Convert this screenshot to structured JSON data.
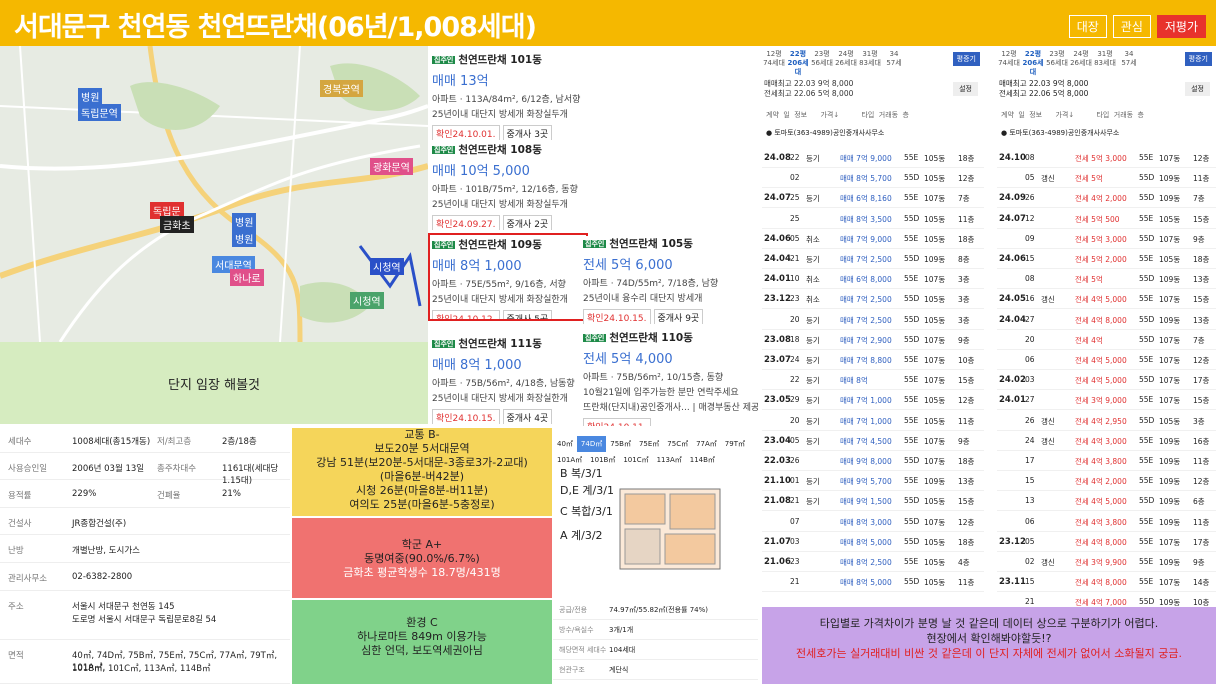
{
  "header": {
    "title": "서대문구 천연동 천연뜨란채(06년/1,008세대)",
    "buttons": [
      "대장",
      "관심",
      "저평가"
    ]
  },
  "map": {
    "labels": [
      "병원",
      "독립문역",
      "경복궁역",
      "광화문역",
      "독립문",
      "금화초",
      "병원",
      "병원",
      "서대문역",
      "하나로",
      "시청역",
      "시청역"
    ]
  },
  "impression": "단지 임장 해볼것",
  "listings": [
    {
      "tag": "집주인",
      "name": "천연뜨란채 101동",
      "price": "매매 13억",
      "line1": "아파트 · 113A/84m², 6/12층, 남서향",
      "line2": "25년이내  대단지  방세개  화장실두개",
      "date": "확인24.10.01.",
      "agents": "중개사 3곳"
    },
    {
      "tag": "집주인",
      "name": "천연뜨란채 108동",
      "price": "매매 10억 5,000",
      "line1": "아파트 · 101B/75m², 12/16층, 동향",
      "line2": "25년이내  대단지  방세개  화장실두개",
      "date": "확인24.09.27.",
      "agents": "중개사 2곳"
    },
    {
      "tag": "집주인",
      "name": "천연뜨란채 109동",
      "price": "매매 8억 1,000",
      "line1": "아파트 · 75E/55m², 9/16층, 서향",
      "line2": "25년이내  대단지  방세개  화장실한개",
      "date": "확인24.10.12.",
      "agents": "중개사 5곳"
    },
    {
      "tag": "집주인",
      "name": "천연뜨란채 105동",
      "price": "전세 5억 6,000",
      "line1": "아파트 · 74D/55m², 7/18층, 남향",
      "line2": "25년이내  융수리  대단지  방세개",
      "date": "확인24.10.15.",
      "agents": "중개사 9곳"
    },
    {
      "tag": "집주인",
      "name": "천연뜨란채 111동",
      "price": "매매 8억 1,000",
      "line1": "아파트 · 75B/56m², 4/18층, 남동향",
      "line2": "25년이내  대단지  방세개  화장실한개",
      "date": "확인24.10.15.",
      "agents": "중개사 4곳"
    },
    {
      "tag": "집주인",
      "name": "천연뜨란채 110동",
      "price": "전세 5억 4,000",
      "line1": "아파트 · 75B/56m², 10/15층, 동향",
      "line2": "10월21일에 입주가능한 분만 연락주세요",
      "line3": "뜨란채(단지내)공인중개사...  | 매경부동산 제공",
      "date": "확인24.10.11.",
      "agents": ""
    }
  ],
  "info": [
    {
      "k": "세대수",
      "v": "1008세대(총15개동)",
      "k2": "저/최고층",
      "v2": "2층/18층"
    },
    {
      "k": "사용승인일",
      "v": "2006년 03월 13일",
      "k2": "총주차대수",
      "v2": "1161대(세대당 1.15대)"
    },
    {
      "k": "용적률",
      "v": "229%",
      "k2": "건폐율",
      "v2": "21%"
    },
    {
      "k": "건설사",
      "v": "JR종합건설(주)",
      "k2": "",
      "v2": ""
    },
    {
      "k": "난방",
      "v": "개별난방, 도시가스",
      "k2": "",
      "v2": ""
    },
    {
      "k": "관리사무소",
      "v": "02-6382-2800",
      "k2": "",
      "v2": ""
    },
    {
      "k": "주소",
      "v": "서울시 서대문구 천연동 145",
      "v3": "도로명  서울시 서대문구 독립문로8길 54",
      "k2": "",
      "v2": ""
    },
    {
      "k": "면적",
      "v": "40㎡, 74D㎡, 75B㎡, 75E㎡, 75C㎡, 77A㎡, 79T㎡, 101A㎡,",
      "v3": "101B㎡, 101C㎡, 113A㎡, 114B㎡",
      "k2": "",
      "v2": ""
    }
  ],
  "commute": {
    "lines": [
      "교통 B-",
      "보도20분 5서대문역",
      "강남 51분(보20분-5서대문-3종로3가-2교대)",
      "(마을6분-버42분)",
      "시청 26분(마을8분-버11분)",
      "여의도 25분(마을6분-5충정로)"
    ],
    "color": "#f5d55a"
  },
  "school": {
    "lines": [
      "학군 A+",
      "동명여중(90.0%/6.7%)"
    ],
    "sub": "금화초 평균학생수 18.7명/431명",
    "color": "#f07270"
  },
  "env": {
    "lines": [
      "환경 C",
      "하나로마트 849m 이용가능",
      "심한 언덕, 보도역세권아님"
    ],
    "color": "#80d28a"
  },
  "floorplan": {
    "tabs": [
      "40㎡",
      "74D㎡",
      "75B㎡",
      "75E㎡",
      "75C㎡",
      "77A㎡",
      "79T㎡",
      "101A㎡",
      "101B㎡",
      "101C㎡",
      "113A㎡",
      "114B㎡"
    ],
    "types": [
      "B 복/3/1",
      "D,E 계/3/1",
      "C 복합/3/1",
      "A 계/3/2"
    ]
  },
  "spec": [
    {
      "k": "공급/전용",
      "v": "74.97㎡/55.82㎡(전용률 74%)"
    },
    {
      "k": "방수/욕실수",
      "v": "3개/1개"
    },
    {
      "k": "해당면적 세대수",
      "v": "104세대"
    },
    {
      "k": "현관구조",
      "v": "계단식"
    }
  ],
  "tbl1": {
    "top": [
      "12평",
      "22평",
      "23평",
      "24평",
      "31평",
      "34"
    ],
    "sub": [
      "74세대",
      "206세대",
      "56세대",
      "26세대",
      "83세대",
      "57세"
    ],
    "btn": "평증기",
    "max1": "매매최고 22.03 9억 8,000",
    "max2": "전세최고 22.06 5억 8,000",
    "set": "설정",
    "cols": "계약  일  정보      가격↓          타입  거래동  층",
    "agent": "토마토(363-4989)공인중개사사무소",
    "rows": [
      [
        "24.08",
        "22",
        "등기",
        "매매 7억 9,000",
        "55E",
        "105동",
        "18층"
      ],
      [
        "",
        "02",
        "",
        "매매 8억 5,700",
        "55D",
        "105동",
        "12층"
      ],
      [
        "24.07",
        "25",
        "등기",
        "매매 6억 8,160",
        "55E",
        "107동",
        "7층"
      ],
      [
        "",
        "25",
        "",
        "매매 8억 3,500",
        "55D",
        "105동",
        "11층"
      ],
      [
        "24.06",
        "05",
        "취소",
        "매매 7억 9,000",
        "55E",
        "105동",
        "18층"
      ],
      [
        "24.04",
        "21",
        "등기",
        "매매 7억 2,500",
        "55D",
        "109동",
        "8층"
      ],
      [
        "24.01",
        "10",
        "취소",
        "매매 6억 8,000",
        "55E",
        "107동",
        "3층"
      ],
      [
        "23.12",
        "23",
        "취소",
        "매매 7억 2,500",
        "55D",
        "105동",
        "3층"
      ],
      [
        "",
        "20",
        "등기",
        "매매 7억 2,500",
        "55D",
        "105동",
        "3층"
      ],
      [
        "23.08",
        "18",
        "등기",
        "매매 7억 2,900",
        "55D",
        "107동",
        "9층"
      ],
      [
        "23.07",
        "24",
        "등기",
        "매매 7억 8,800",
        "55E",
        "107동",
        "10층"
      ],
      [
        "",
        "22",
        "등기",
        "매매 8억",
        "55E",
        "107동",
        "15층"
      ],
      [
        "23.05",
        "29",
        "등기",
        "매매 7억 1,000",
        "55E",
        "105동",
        "12층"
      ],
      [
        "",
        "20",
        "등기",
        "매매 7억 1,000",
        "55E",
        "105동",
        "11층"
      ],
      [
        "23.04",
        "05",
        "등기",
        "매매 7억 4,500",
        "55E",
        "107동",
        "9층"
      ],
      [
        "22.03",
        "26",
        "",
        "매매 9억 8,000",
        "55D",
        "107동",
        "18층"
      ],
      [
        "21.10",
        "01",
        "등기",
        "매매 9억 5,700",
        "55E",
        "109동",
        "13층"
      ],
      [
        "21.08",
        "21",
        "등기",
        "매매 9억 1,500",
        "55D",
        "105동",
        "15층"
      ],
      [
        "",
        "07",
        "",
        "매매 8억 3,000",
        "55D",
        "107동",
        "12층"
      ],
      [
        "21.07",
        "03",
        "",
        "매매 8억 5,000",
        "55D",
        "105동",
        "18층"
      ],
      [
        "21.06",
        "23",
        "",
        "매매 8억 2,500",
        "55E",
        "105동",
        "4층"
      ],
      [
        "",
        "21",
        "",
        "매매 8억 5,000",
        "55D",
        "105동",
        "11층"
      ]
    ]
  },
  "tbl2": {
    "rows": [
      [
        "24.10",
        "08",
        "",
        "전세 5억 3,000",
        "55E",
        "107동",
        "12층"
      ],
      [
        "",
        "05",
        "갱신",
        "전세 5억",
        "55D",
        "109동",
        "11층"
      ],
      [
        "24.09",
        "26",
        "",
        "전세 4억 2,000",
        "55D",
        "109동",
        "7층"
      ],
      [
        "24.07",
        "12",
        "",
        "전세 5억 500",
        "55E",
        "105동",
        "15층"
      ],
      [
        "",
        "09",
        "",
        "전세 5억 3,000",
        "55D",
        "107동",
        "9층"
      ],
      [
        "24.06",
        "15",
        "",
        "전세 5억 2,000",
        "55E",
        "105동",
        "18층"
      ],
      [
        "",
        "08",
        "",
        "전세 5억",
        "55D",
        "109동",
        "13층"
      ],
      [
        "24.05",
        "16",
        "갱신",
        "전세 4억 5,000",
        "55E",
        "107동",
        "15층"
      ],
      [
        "24.04",
        "27",
        "",
        "전세 4억 8,000",
        "55D",
        "109동",
        "13층"
      ],
      [
        "",
        "20",
        "",
        "전세 4억",
        "55D",
        "107동",
        "7층"
      ],
      [
        "",
        "06",
        "",
        "전세 4억 5,000",
        "55E",
        "107동",
        "12층"
      ],
      [
        "24.02",
        "03",
        "",
        "전세 4억 5,000",
        "55D",
        "107동",
        "17층"
      ],
      [
        "24.01",
        "27",
        "",
        "전세 3억 9,000",
        "55E",
        "107동",
        "15층"
      ],
      [
        "",
        "26",
        "갱신",
        "전세 4억 2,950",
        "55D",
        "105동",
        "3층"
      ],
      [
        "",
        "24",
        "갱신",
        "전세 4억 3,000",
        "55E",
        "109동",
        "16층"
      ],
      [
        "",
        "17",
        "",
        "전세 4억 3,800",
        "55E",
        "109동",
        "11층"
      ],
      [
        "",
        "15",
        "",
        "전세 4억 2,000",
        "55E",
        "109동",
        "12층"
      ],
      [
        "",
        "13",
        "",
        "전세 4억 5,000",
        "55D",
        "109동",
        "6층"
      ],
      [
        "",
        "06",
        "",
        "전세 4억 3,800",
        "55E",
        "109동",
        "11층"
      ],
      [
        "23.12",
        "05",
        "",
        "전세 4억 8,000",
        "55E",
        "107동",
        "17층"
      ],
      [
        "",
        "02",
        "갱신",
        "전세 3억 9,900",
        "55E",
        "109동",
        "9층"
      ],
      [
        "23.11",
        "15",
        "",
        "전세 4억 8,000",
        "55E",
        "107동",
        "14층"
      ],
      [
        "",
        "21",
        "",
        "전세 4억 7,000",
        "55D",
        "109동",
        "10층"
      ]
    ]
  },
  "purple": {
    "l1": "타입별로 가격차이가 분명 날 것 같은데 데이터 상으로 구분하기가 어렵다.",
    "l2": "현장에서 확인해봐야할듯!?",
    "l3": "전세호가는 실거래대비 비싼 것 같은데 이 단지 자체에 전세가 없어서 소화될지 궁금."
  }
}
